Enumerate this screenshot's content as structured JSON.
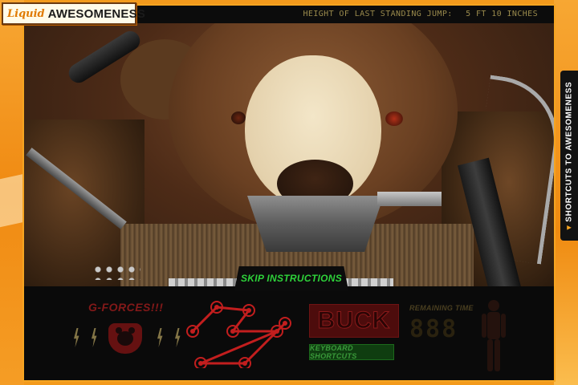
{
  "logo": {
    "part1": "Liquid",
    "part2": "AWESOMENESS"
  },
  "status": {
    "label": "HEIGHT OF LAST STANDING JUMP:",
    "value": "5 FT 10 INCHES"
  },
  "skip_button": {
    "label": "SKIP INSTRUCTIONS"
  },
  "panel": {
    "gforces_title": "G-FORCES!!!",
    "buck_label": "BUCK",
    "keyboard_shortcuts_label": "KEYBOARD SHORTCUTS",
    "remaining_time_label": "REMAINING TIME",
    "remaining_time_value": "888"
  },
  "side_tab": {
    "label": "SHORTCUTS TO AWESOMENESS",
    "arrow": "▾"
  },
  "colors": {
    "accent_orange": "#f5a421",
    "skip_green": "#2ed23a",
    "status_text": "#9a8a4c",
    "buck_red": "#4d0c0c",
    "pattern_red": "#c21e1e"
  },
  "icons": [
    "bear-badge-icon",
    "lightning-bolt-icon",
    "figure-silhouette-icon",
    "dot-pattern-icon"
  ]
}
